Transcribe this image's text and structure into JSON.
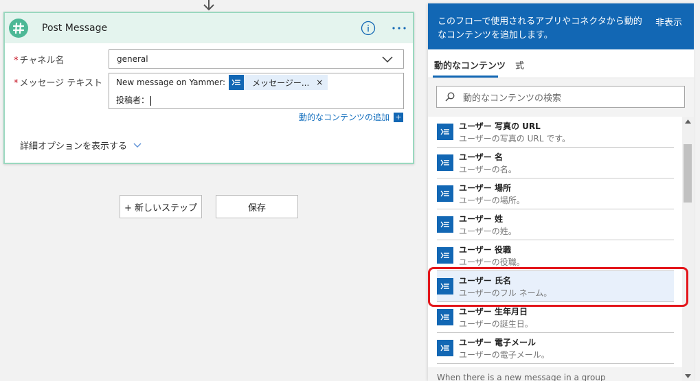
{
  "card": {
    "title": "Post Message",
    "channel_label": "チャネル名",
    "channel_value": "general",
    "message_label": "メッセージ テキスト",
    "message_prefix": "New message on Yammer:",
    "token_label": "メッセージー...",
    "token_close": "×",
    "message_line2": "投稿者：",
    "add_dynamic_label": "動的なコンテンツの追加",
    "add_dynamic_plus": "+",
    "advanced_label": "詳細オプションを表示する",
    "required_mark": "*"
  },
  "actions": {
    "new_step_label": "+ 新しいステップ",
    "save_label": "保存"
  },
  "panel": {
    "header_text": "このフローで使用されるアプリやコネクタから動的なコンテンツを追加します。",
    "hide_label": "非表示",
    "tabs": [
      {
        "label": "動的なコンテンツ"
      },
      {
        "label": "式"
      }
    ],
    "search_placeholder": "動的なコンテンツの検索",
    "items": [
      {
        "title": "ユーザー 写真の URL",
        "desc": "ユーザーの写真の URL です。"
      },
      {
        "title": "ユーザー 名",
        "desc": "ユーザーの名。"
      },
      {
        "title": "ユーザー 場所",
        "desc": "ユーザーの場所。"
      },
      {
        "title": "ユーザー 姓",
        "desc": "ユーザーの姓。"
      },
      {
        "title": "ユーザー 役職",
        "desc": "ユーザーの役職。"
      },
      {
        "title": "ユーザー 氏名",
        "desc": "ユーザーのフル ネーム。"
      },
      {
        "title": "ユーザー 生年月日",
        "desc": "ユーザーの誕生日。"
      },
      {
        "title": "ユーザー 電子メール",
        "desc": "ユーザーの電子メール。"
      }
    ],
    "footer_text": "When there is a new message in a group"
  },
  "colors": {
    "accent": "#1267b4",
    "card_border": "#9ad8bf",
    "highlight": "#e3161b"
  }
}
